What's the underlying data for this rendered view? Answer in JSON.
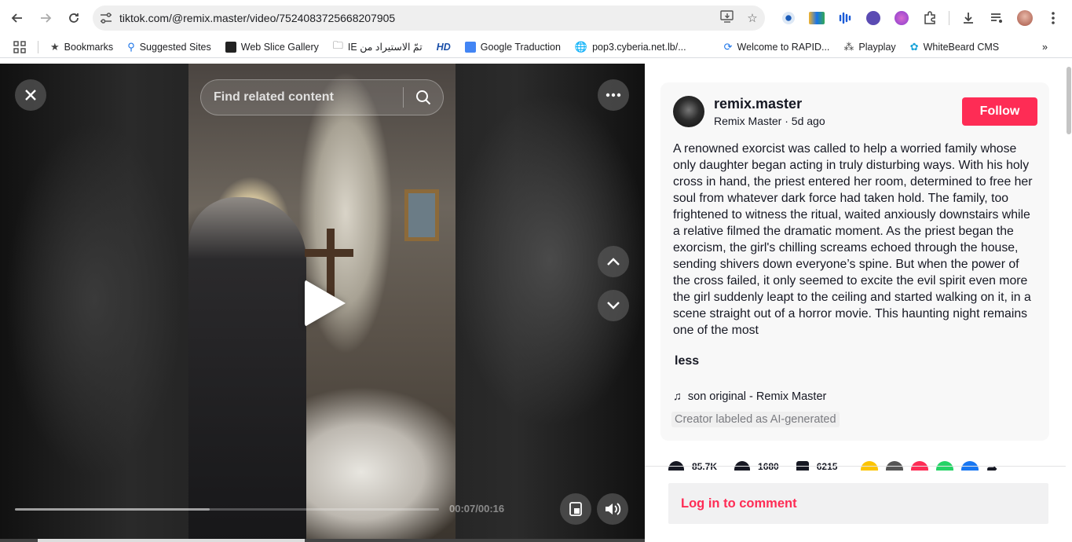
{
  "browser": {
    "url": "tiktok.com/@remix.master/video/7524083725668207905",
    "bookmarks": [
      {
        "label": "Bookmarks",
        "icon": "star-icon"
      },
      {
        "label": "Suggested Sites",
        "icon": "search-icon"
      },
      {
        "label": "Web Slice Gallery",
        "icon": "web-slice-icon"
      },
      {
        "label": "IE تمّ الاستيراد من",
        "icon": "folder-icon"
      },
      {
        "label": "HD",
        "icon": "hd-icon"
      },
      {
        "label": "Google Traduction",
        "icon": "translate-icon"
      },
      {
        "label": "pop3.cyberia.net.lb/...",
        "icon": "globe-icon"
      },
      {
        "label": "Welcome to RAPID...",
        "icon": "rapid-icon"
      },
      {
        "label": "Playplay",
        "icon": "playplay-icon"
      },
      {
        "label": "WhiteBeard CMS",
        "icon": "whitebeard-icon"
      }
    ]
  },
  "video": {
    "search_placeholder": "Find related content",
    "time": "00:07/00:16",
    "progress": 0.46
  },
  "post": {
    "handle": "remix.master",
    "author_line": "Remix Master · 5d ago",
    "follow_label": "Follow",
    "description": "A renowned exorcist was called to help a worried family whose only daughter began acting in truly disturbing ways. With his holy cross in hand, the priest entered her room, determined to free her soul from whatever dark force had taken hold. The family, too frightened to witness the ritual, waited anxiously downstairs while a relative filmed the dramatic moment. As the priest began the exorcism, the girl's chilling screams echoed through the house, sending shivers down everyone’s spine. But when the power of the cross failed, it only seemed to excite the evil spirit even more the girl suddenly leapt to the ceiling and started walking on it, in a scene straight out of a horror movie. This haunting night remains one of the most",
    "less_label": "less",
    "music": "son original - Remix Master",
    "ai_label": "Creator labeled as AI-generated",
    "likes": "85.7K",
    "comments": "1680",
    "saves": "6215",
    "login_comment": "Log in to comment"
  },
  "colors": {
    "follow": "#fe2c55",
    "login_text": "#fe2c55"
  }
}
